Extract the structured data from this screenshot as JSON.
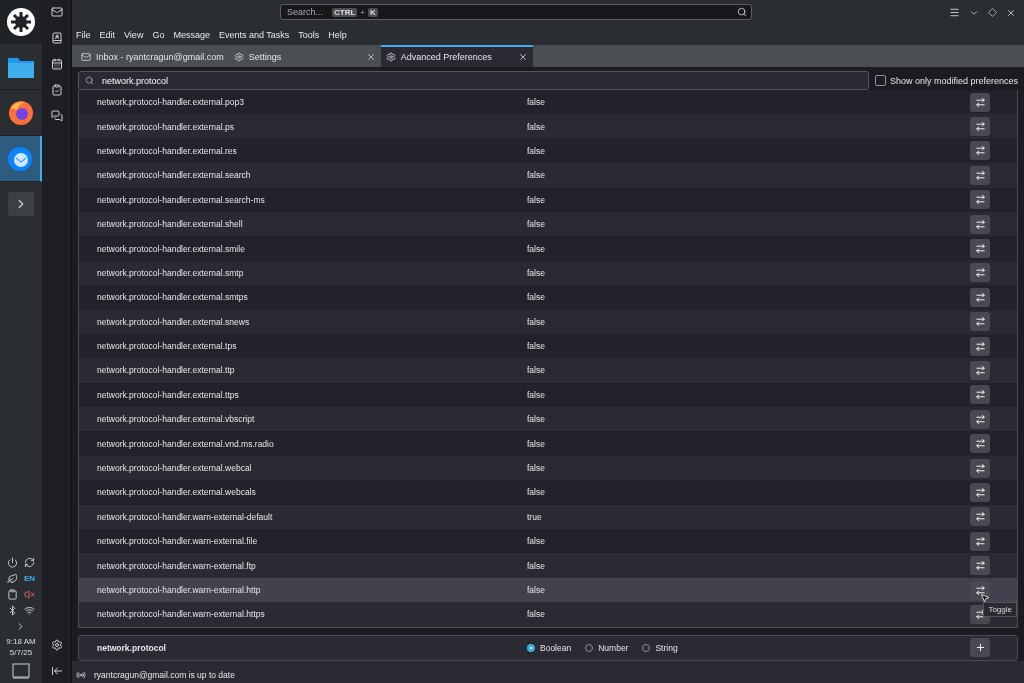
{
  "taskbar": {
    "apps": [
      {
        "kind": "files",
        "active": false
      },
      {
        "kind": "browser",
        "active": false
      },
      {
        "kind": "mail",
        "active": true
      }
    ],
    "tray": {
      "language": "EN",
      "time": "9:18 AM",
      "date": "5/7/25"
    }
  },
  "search": {
    "placeholder": "Search...",
    "keys": [
      "CTRL",
      "K"
    ],
    "joiner": "+"
  },
  "menu": [
    "File",
    "Edit",
    "View",
    "Go",
    "Message",
    "Events and Tasks",
    "Tools",
    "Help"
  ],
  "tabs": [
    {
      "label": "Inbox - ryantcragun@gmail.com",
      "kind": "mail",
      "selected": false,
      "closable": false
    },
    {
      "label": "Settings",
      "kind": "settings",
      "selected": false,
      "closable": true
    },
    {
      "label": "Advanced Preferences",
      "kind": "settings",
      "selected": true,
      "closable": true
    }
  ],
  "filter": {
    "value": "network.protocol",
    "modified_only": {
      "label": "Show only modified preferences",
      "checked": false
    }
  },
  "prefs": [
    {
      "name": "network.protocol-handler.external.pop3",
      "value": "false",
      "hovered": false
    },
    {
      "name": "network.protocol-handler.external.ps",
      "value": "false",
      "hovered": false
    },
    {
      "name": "network.protocol-handler.external.res",
      "value": "false",
      "hovered": false
    },
    {
      "name": "network.protocol-handler.external.search",
      "value": "false",
      "hovered": false
    },
    {
      "name": "network.protocol-handler.external.search-ms",
      "value": "false",
      "hovered": false
    },
    {
      "name": "network.protocol-handler.external.shell",
      "value": "false",
      "hovered": false
    },
    {
      "name": "network.protocol-handler.external.smile",
      "value": "false",
      "hovered": false
    },
    {
      "name": "network.protocol-handler.external.smtp",
      "value": "false",
      "hovered": false
    },
    {
      "name": "network.protocol-handler.external.smtps",
      "value": "false",
      "hovered": false
    },
    {
      "name": "network.protocol-handler.external.snews",
      "value": "false",
      "hovered": false
    },
    {
      "name": "network.protocol-handler.external.tps",
      "value": "false",
      "hovered": false
    },
    {
      "name": "network.protocol-handler.external.ttp",
      "value": "false",
      "hovered": false
    },
    {
      "name": "network.protocol-handler.external.ttps",
      "value": "false",
      "hovered": false
    },
    {
      "name": "network.protocol-handler.external.vbscript",
      "value": "false",
      "hovered": false
    },
    {
      "name": "network.protocol-handler.external.vnd.ms.radio",
      "value": "false",
      "hovered": false
    },
    {
      "name": "network.protocol-handler.external.webcal",
      "value": "false",
      "hovered": false
    },
    {
      "name": "network.protocol-handler.external.webcals",
      "value": "false",
      "hovered": false
    },
    {
      "name": "network.protocol-handler.warn-external-default",
      "value": "true",
      "hovered": false
    },
    {
      "name": "network.protocol-handler.warn-external.file",
      "value": "false",
      "hovered": false
    },
    {
      "name": "network.protocol-handler.warn-external.ftp",
      "value": "false",
      "hovered": false
    },
    {
      "name": "network.protocol-handler.warn-external.http",
      "value": "false",
      "hovered": true
    },
    {
      "name": "network.protocol-handler.warn-external.https",
      "value": "false",
      "hovered": false
    }
  ],
  "tooltip": "Toggle",
  "new_pref": {
    "name": "network.protocol",
    "types": [
      {
        "label": "Boolean",
        "selected": true
      },
      {
        "label": "Number",
        "selected": false
      },
      {
        "label": "String",
        "selected": false
      }
    ]
  },
  "status": "ryantcragun@gmail.com is up to date"
}
